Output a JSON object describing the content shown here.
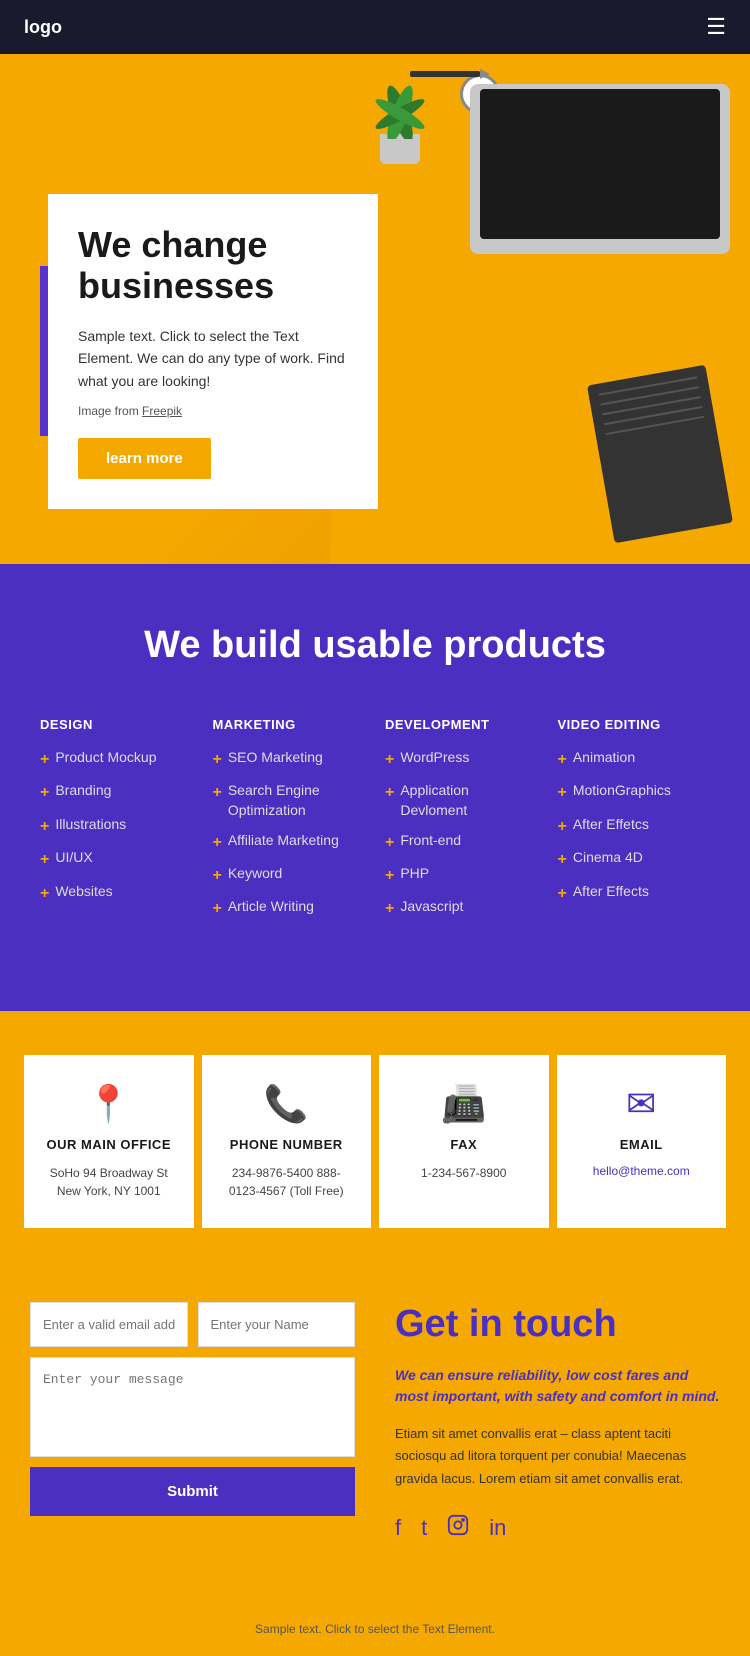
{
  "navbar": {
    "logo": "logo",
    "menu_icon": "☰"
  },
  "hero": {
    "title": "We change businesses",
    "subtitle": "Sample text. Click to select the Text Element. We can do any type of work. Find what you are looking!",
    "image_credit_text": "Image from ",
    "image_credit_link": "Freepik",
    "btn_label": "learn more"
  },
  "purple_section": {
    "title": "We build usable products",
    "columns": [
      {
        "heading": "DESIGN",
        "items": [
          "Product Mockup",
          "Branding",
          "Illustrations",
          "UI/UX",
          "Websites"
        ]
      },
      {
        "heading": "MARKETING",
        "items": [
          "SEO Marketing",
          "Search Engine Optimization",
          "Affiliate Marketing",
          "Keyword",
          "Article Writing"
        ]
      },
      {
        "heading": "DEVELOPMENT",
        "items": [
          "WordPress",
          "Application Devloment",
          "Front-end",
          "PHP",
          "Javascript"
        ]
      },
      {
        "heading": "VIDEO EDITING",
        "items": [
          "Animation",
          "MotionGraphics",
          "After Effetcs",
          "Cinema 4D",
          "After Effects"
        ]
      }
    ]
  },
  "contact_cards": [
    {
      "icon": "📍",
      "title": "OUR MAIN OFFICE",
      "text": "SoHo 94 Broadway St New York, NY 1001"
    },
    {
      "icon": "📞",
      "title": "PHONE NUMBER",
      "text": "234-9876-5400\n888-0123-4567 (Toll Free)"
    },
    {
      "icon": "📠",
      "title": "FAX",
      "text": "1-234-567-8900"
    },
    {
      "icon": "✉",
      "title": "EMAIL",
      "email": "hello@theme.com"
    }
  ],
  "contact_form": {
    "email_placeholder": "Enter a valid email address",
    "name_placeholder": "Enter your Name",
    "message_placeholder": "Enter your message",
    "submit_label": "Submit"
  },
  "get_in_touch": {
    "title": "Get in touch",
    "subtitle": "We can ensure reliability, low cost fares and most important, with safety and comfort in mind.",
    "body": "Etiam sit amet convallis erat – class aptent taciti sociosqu ad litora torquent per conubia! Maecenas gravida lacus. Lorem etiam sit amet convallis erat."
  },
  "footer": {
    "text": "Sample text. Click to select the Text Element."
  }
}
